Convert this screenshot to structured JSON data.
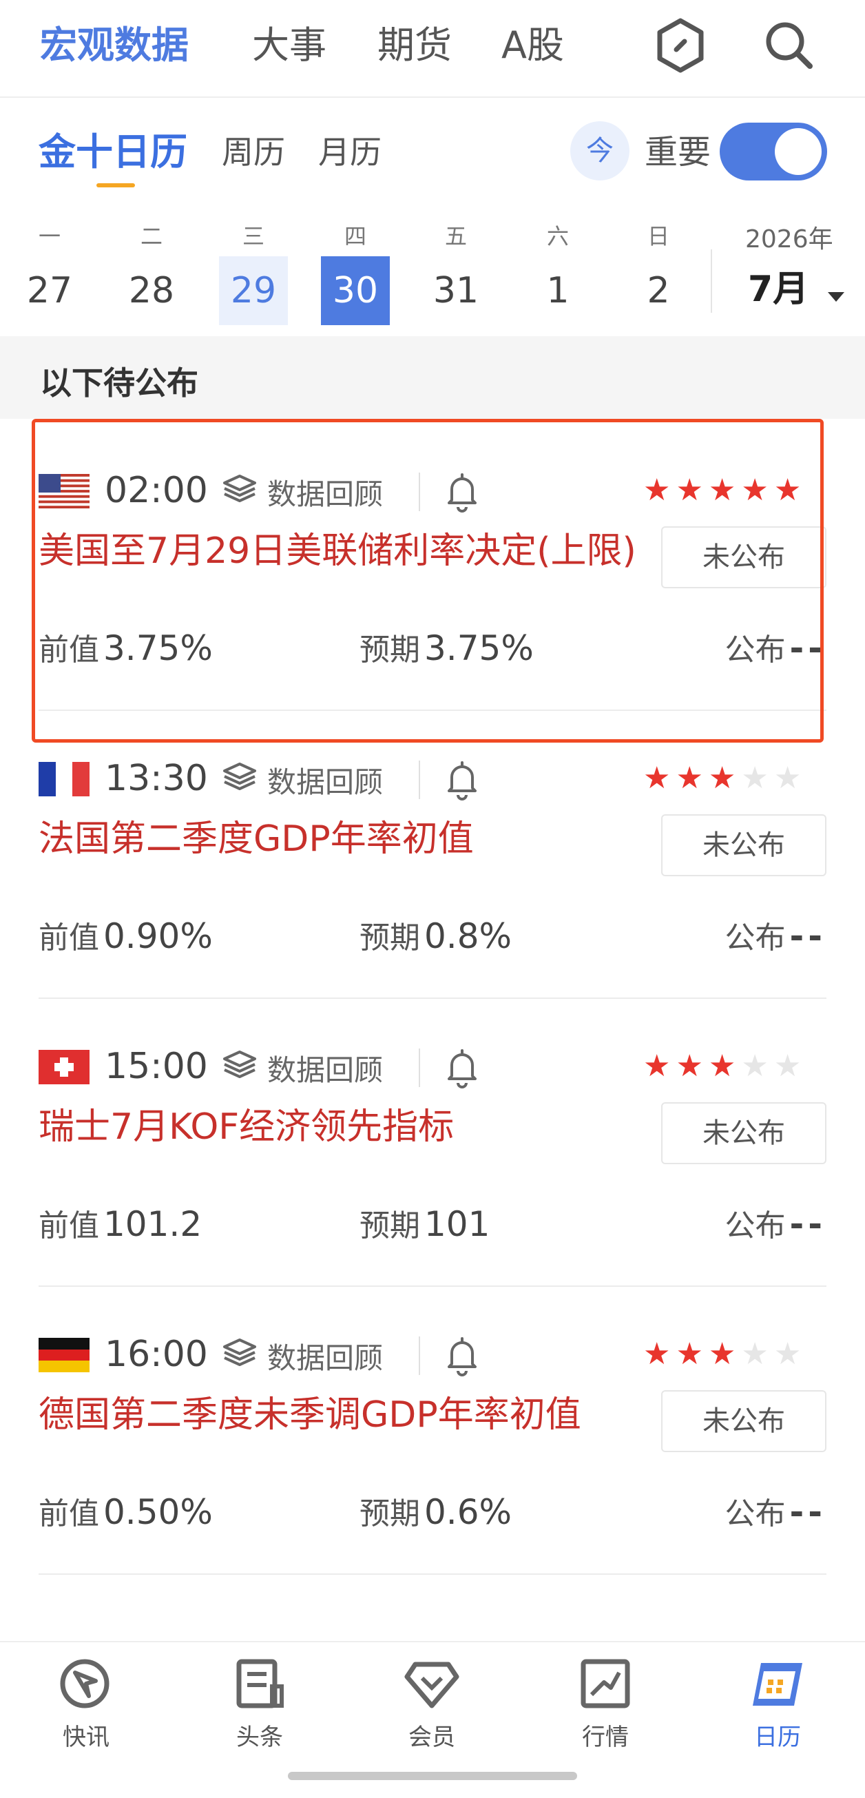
{
  "top_nav": {
    "tabs": [
      {
        "label": "宏观数据",
        "active": true
      },
      {
        "label": "大事",
        "active": false
      },
      {
        "label": "期货",
        "active": false
      },
      {
        "label": "A股",
        "active": false
      }
    ],
    "icons": [
      "hexagon-icon",
      "search-icon"
    ]
  },
  "sub_tabs": {
    "items": [
      {
        "label": "金十日历",
        "active": true
      },
      {
        "label": "周历",
        "active": false
      },
      {
        "label": "月历",
        "active": false
      }
    ],
    "today_label": "今",
    "important_label": "重要",
    "important_on": true
  },
  "week": {
    "weekdays": [
      "一",
      "二",
      "三",
      "四",
      "五",
      "六",
      "日"
    ],
    "days": [
      "27",
      "28",
      "29",
      "30",
      "31",
      "1",
      "2"
    ],
    "prev_selected_day": "29",
    "selected_day": "30",
    "year": "2026年",
    "month": "7月"
  },
  "section_title": "以下待公布",
  "labels": {
    "data_review": "数据回顾",
    "prev": "前值",
    "forecast": "预期",
    "actual": "公布"
  },
  "events": [
    {
      "flag": "us-flag",
      "time": "02:00",
      "stars": 5,
      "title": "美国至7月29日美联储利率决定(上限)",
      "status": "未公布",
      "prev": "3.75%",
      "forecast": "3.75%",
      "actual": "--",
      "highlighted": true
    },
    {
      "flag": "fr-flag",
      "time": "13:30",
      "stars": 3,
      "title": "法国第二季度GDP年率初值",
      "status": "未公布",
      "prev": "0.90%",
      "forecast": "0.8%",
      "actual": "--",
      "highlighted": false
    },
    {
      "flag": "ch-flag",
      "time": "15:00",
      "stars": 3,
      "title": "瑞士7月KOF经济领先指标",
      "status": "未公布",
      "prev": "101.2",
      "forecast": "101",
      "actual": "--",
      "highlighted": false
    },
    {
      "flag": "de-flag",
      "time": "16:00",
      "stars": 3,
      "title": "德国第二季度未季调GDP年率初值",
      "status": "未公布",
      "prev": "0.50%",
      "forecast": "0.6%",
      "actual": "--",
      "highlighted": false
    }
  ],
  "bottom_nav": [
    {
      "label": "快讯",
      "icon": "flash-news-icon",
      "active": false
    },
    {
      "label": "头条",
      "icon": "headline-icon",
      "active": false
    },
    {
      "label": "会员",
      "icon": "member-diamond-icon",
      "active": false
    },
    {
      "label": "行情",
      "icon": "market-chart-icon",
      "active": false
    },
    {
      "label": "日历",
      "icon": "calendar-icon",
      "active": true
    }
  ],
  "colors": {
    "accent": "#4e7be0",
    "event_title": "#c7302b",
    "star_on": "#e8352d",
    "highlight_border": "#f04a24"
  }
}
